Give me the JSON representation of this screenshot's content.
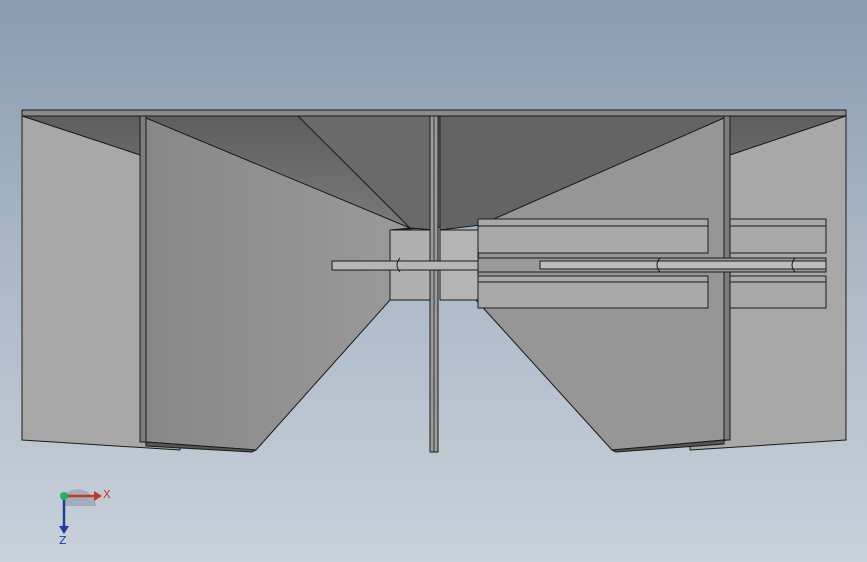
{
  "viewport": {
    "background_top": "#8a9bb0",
    "background_bottom": "#c9d1da"
  },
  "model": {
    "face_light": "#a7a7a7",
    "face_mid": "#8e8e8e",
    "face_dark": "#6e6e6e",
    "edge_color": "#1a1a1a"
  },
  "triad": {
    "x_label": "X",
    "z_label": "Z",
    "x_color": "#c0392b",
    "y_color": "#27ae60",
    "z_color": "#1f3f9a"
  }
}
